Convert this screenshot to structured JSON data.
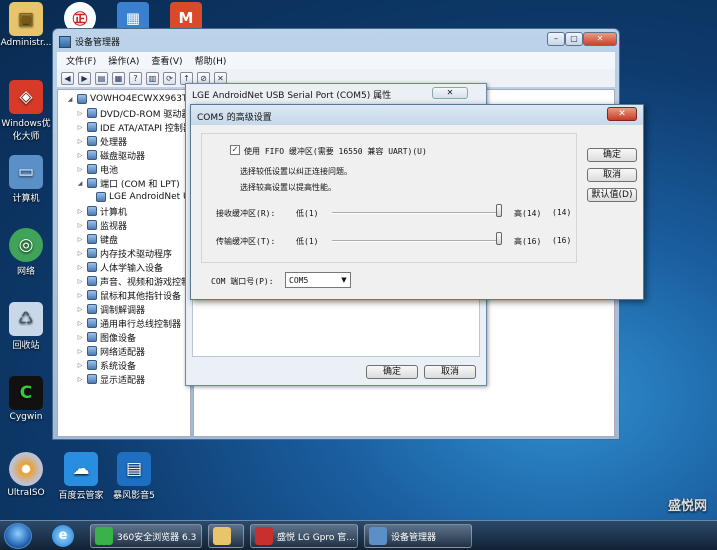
{
  "desktop": {
    "icons": [
      {
        "label": "Administr..."
      },
      {
        "label": "Windows优化大师"
      },
      {
        "label": "计算机"
      },
      {
        "label": "网络"
      },
      {
        "label": "回收站"
      },
      {
        "label": "Cygwin"
      },
      {
        "label": "UltraISO"
      },
      {
        "label": "百度云管家"
      },
      {
        "label": "暴风影音5"
      }
    ],
    "watermark": "盛悦网"
  },
  "devmgr": {
    "title": "设备管理器",
    "menu": [
      "文件(F)",
      "操作(A)",
      "查看(V)",
      "帮助(H)"
    ],
    "tree": [
      {
        "label": "VOWHO4ECWXX963T",
        "expand": "◢"
      },
      {
        "label": "DVD/CD-ROM 驱动器",
        "expand": "▷"
      },
      {
        "label": "IDE ATA/ATAPI 控制器",
        "expand": "▷"
      },
      {
        "label": "处理器",
        "expand": "▷"
      },
      {
        "label": "磁盘驱动器",
        "expand": "▷"
      },
      {
        "label": "电池",
        "expand": "▷"
      },
      {
        "label": "端口 (COM 和 LPT)",
        "expand": "◢"
      },
      {
        "label": "LGE AndroidNet USB Serial Port (COM5)",
        "expand": ""
      },
      {
        "label": "计算机",
        "expand": "▷"
      },
      {
        "label": "监视器",
        "expand": "▷"
      },
      {
        "label": "键盘",
        "expand": "▷"
      },
      {
        "label": "内存技术驱动程序",
        "expand": "▷"
      },
      {
        "label": "人体学输入设备",
        "expand": "▷"
      },
      {
        "label": "声音、视频和游戏控制器",
        "expand": "▷"
      },
      {
        "label": "鼠标和其他指针设备",
        "expand": "▷"
      },
      {
        "label": "调制解调器",
        "expand": "▷"
      },
      {
        "label": "通用串行总线控制器",
        "expand": "▷"
      },
      {
        "label": "图像设备",
        "expand": "▷"
      },
      {
        "label": "网络适配器",
        "expand": "▷"
      },
      {
        "label": "系统设备",
        "expand": "▷"
      },
      {
        "label": "显示适配器",
        "expand": "▷"
      }
    ]
  },
  "props": {
    "title": "LGE AndroidNet USB Serial Port (COM5) 属性",
    "ok": "确定",
    "cancel": "取消"
  },
  "adv": {
    "title": "COM5 的高级设置",
    "fifo_label": "使用 FIFO 缓冲区(需要 16550 兼容 UART)(U)",
    "fifo_checked": true,
    "hint1": "选择较低设置以纠正连接问题。",
    "hint2": "选择较高设置以提高性能。",
    "rx_label": "接收缓冲区(R):",
    "rx_low": "低(1)",
    "rx_high": "高(14)",
    "rx_value": "(14)",
    "rx_level": 1.0,
    "tx_label": "传输缓冲区(T):",
    "tx_low": "低(1)",
    "tx_high": "高(16)",
    "tx_value": "(16)",
    "tx_level": 1.0,
    "com_label": "COM 端口号(P):",
    "com_value": "COM5",
    "ok": "确定",
    "cancel": "取消",
    "defaults": "默认值(D)"
  },
  "taskbar": {
    "items": [
      {
        "label": "360安全浏览器 6.3"
      },
      {
        "label": ""
      },
      {
        "label": "盛悦 LG Gpro 官..."
      },
      {
        "label": "设备管理器"
      }
    ]
  },
  "colors": {
    "accent": "#2f6aa8",
    "close": "#c63c22"
  }
}
